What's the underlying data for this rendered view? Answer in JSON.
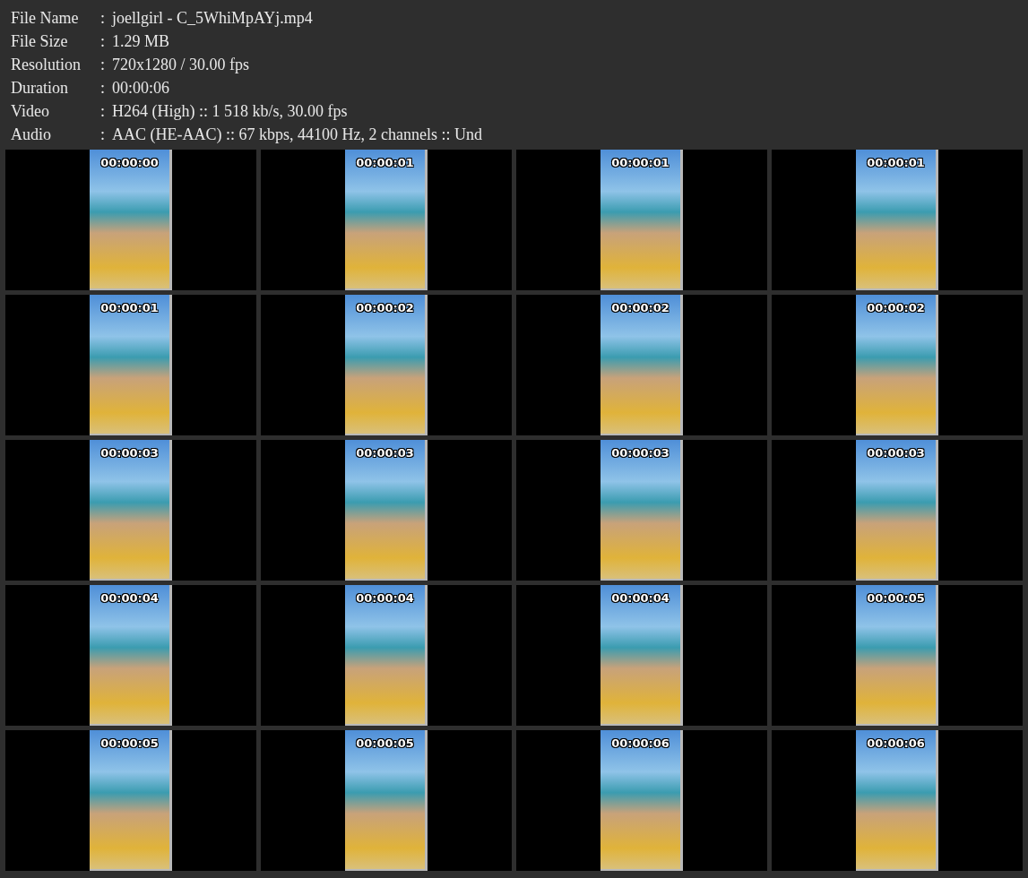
{
  "info": [
    {
      "label": "File Name",
      "value": "joellgirl - C_5WhiMpAYj.mp4"
    },
    {
      "label": "File Size",
      "value": "1.29 MB"
    },
    {
      "label": "Resolution",
      "value": "720x1280 / 30.00 fps"
    },
    {
      "label": "Duration",
      "value": "00:00:06"
    },
    {
      "label": "Video",
      "value": "H264 (High) :: 1 518 kb/s, 30.00 fps"
    },
    {
      "label": "Audio",
      "value": "AAC (HE-AAC) :: 67 kbps, 44100 Hz, 2 channels :: Und"
    }
  ],
  "separator": ":",
  "frames": [
    {
      "time": "00:00:00"
    },
    {
      "time": "00:00:01"
    },
    {
      "time": "00:00:01"
    },
    {
      "time": "00:00:01"
    },
    {
      "time": "00:00:01"
    },
    {
      "time": "00:00:02"
    },
    {
      "time": "00:00:02"
    },
    {
      "time": "00:00:02"
    },
    {
      "time": "00:00:03"
    },
    {
      "time": "00:00:03"
    },
    {
      "time": "00:00:03"
    },
    {
      "time": "00:00:03"
    },
    {
      "time": "00:00:04"
    },
    {
      "time": "00:00:04"
    },
    {
      "time": "00:00:04"
    },
    {
      "time": "00:00:05"
    },
    {
      "time": "00:00:05"
    },
    {
      "time": "00:00:05"
    },
    {
      "time": "00:00:06"
    },
    {
      "time": "00:00:06"
    }
  ]
}
